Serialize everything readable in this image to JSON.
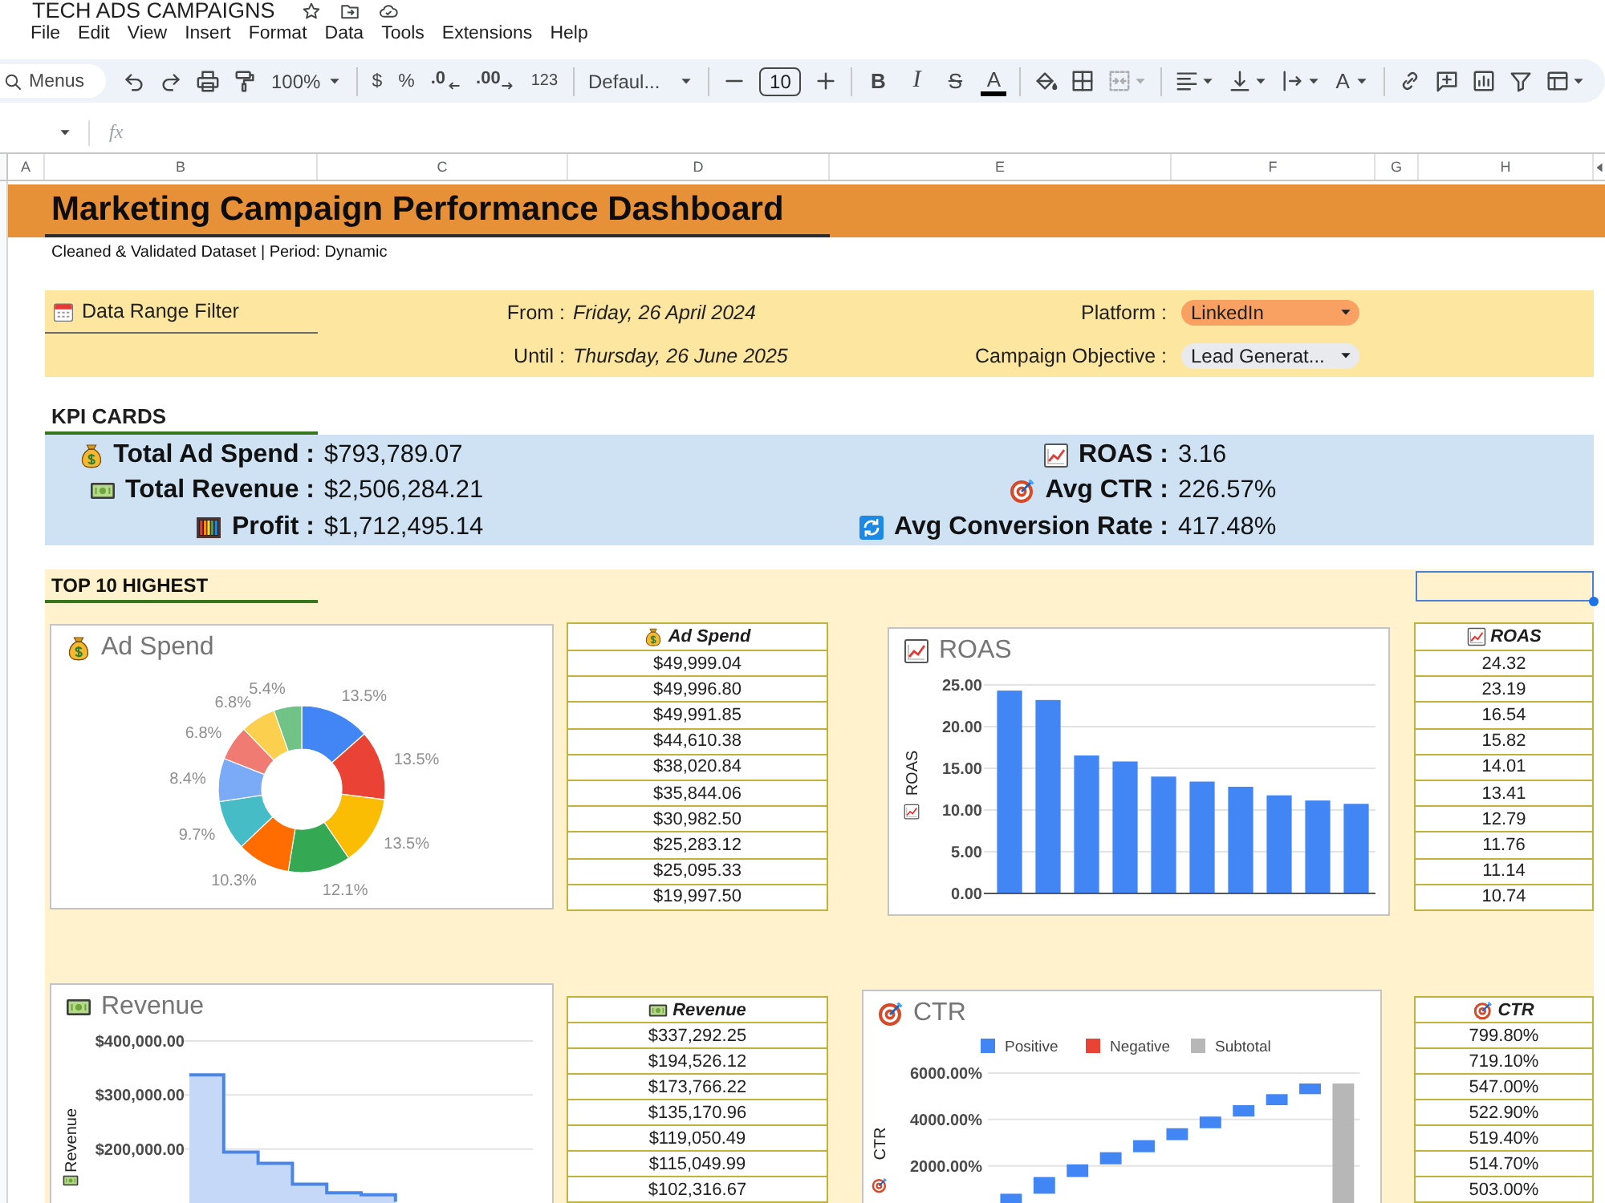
{
  "document": {
    "title": "TECH ADS CAMPAIGNS"
  },
  "menu": [
    "File",
    "Edit",
    "View",
    "Insert",
    "Format",
    "Data",
    "Tools",
    "Extensions",
    "Help"
  ],
  "toolbar": {
    "search": {
      "placeholder": "Menus"
    },
    "zoom": "100%",
    "number_formats": [
      {
        "kind": "currency",
        "label": "$"
      },
      {
        "kind": "percent",
        "label": "%"
      },
      {
        "kind": "decrease_decimals",
        "label": ".0"
      },
      {
        "kind": "increase_decimals",
        "label": ".00"
      },
      {
        "kind": "more_formats",
        "label": "123"
      }
    ],
    "font": "Defaul...",
    "font_size": "10",
    "text_styles": [
      {
        "kind": "bold",
        "label": "B"
      },
      {
        "kind": "italic",
        "label": "I"
      },
      {
        "kind": "strikethrough",
        "label": "S"
      },
      {
        "kind": "text_color",
        "label": "A"
      }
    ],
    "merge_cells": {
      "disabled": true
    },
    "rotate": "A"
  },
  "formula_bar": {
    "label": "fx"
  },
  "columns": [
    "A",
    "B",
    "C",
    "D",
    "E",
    "F",
    "G",
    "H"
  ],
  "dashboard": {
    "title": "Marketing Campaign Performance Dashboard",
    "subtitle": "Cleaned & Validated Dataset | Period: Dynamic",
    "filter": {
      "heading": "Data Range Filter",
      "dates": [
        {
          "label": "From :",
          "value": "Friday, 26 April 2024"
        },
        {
          "label": "Until :",
          "value": "Thursday, 26 June 2025"
        }
      ],
      "dropdowns": [
        {
          "label": "Platform :",
          "value": "LinkedIn",
          "color": "#f9a063"
        },
        {
          "label": "Campaign Objective :",
          "value": "Lead Generat...",
          "color": "#e8eaed"
        }
      ]
    },
    "kpi": {
      "heading": "KPI CARDS",
      "left": [
        {
          "label": "Total Ad Spend :",
          "value": "$793,789.07"
        },
        {
          "label": "Total Revenue :",
          "value": "$2,506,284.21"
        },
        {
          "label": "Profit :",
          "value": "$1,712,495.14"
        }
      ],
      "right": [
        {
          "label": "ROAS :",
          "value": "3.16"
        },
        {
          "label": "Avg CTR :",
          "value": "226.57%"
        },
        {
          "label": "Avg Conversion Rate :",
          "value": "417.48%"
        }
      ]
    },
    "top10": {
      "heading": "TOP 10 HIGHEST",
      "selected_cell": {
        "selected": true
      },
      "panels": [
        {
          "chart_data": {
            "type": "donut",
            "title": "Ad Spend",
            "values": [
              13.5,
              13.5,
              13.5,
              12.1,
              10.3,
              9.7,
              8.4,
              6.8,
              6.8,
              5.4
            ],
            "colors": [
              "#4285f4",
              "#ea4335",
              "#fbbc04",
              "#34a853",
              "#ff6d01",
              "#46bdc6",
              "#7baaf7",
              "#f07b72",
              "#fcd04f",
              "#71c287"
            ],
            "value_labels": [
              "13.5%",
              "13.5%",
              "13.5%",
              "12.1%",
              "10.3%",
              "9.7%",
              "8.4%",
              "6.8%",
              "6.8%",
              "5.4%"
            ]
          },
          "table": {
            "header": "Ad Spend",
            "rows": [
              "$49,999.04",
              "$49,996.80",
              "$49,991.85",
              "$44,610.38",
              "$38,020.84",
              "$35,844.06",
              "$30,982.50",
              "$25,283.12",
              "$25,095.33",
              "$19,997.50"
            ]
          }
        },
        {
          "chart_data": {
            "type": "bar",
            "title": "ROAS",
            "ylabel": "ROAS",
            "values": [
              24.32,
              23.19,
              16.54,
              15.82,
              14.01,
              13.41,
              12.79,
              11.76,
              11.14,
              10.74
            ],
            "color": "#4285f4",
            "ylim": [
              0,
              25
            ],
            "yticks": [
              {
                "value": 0,
                "label": "0.00"
              },
              {
                "value": 5,
                "label": "5.00"
              },
              {
                "value": 10,
                "label": "10.00"
              },
              {
                "value": 15,
                "label": "15.00"
              },
              {
                "value": 20,
                "label": "20.00"
              },
              {
                "value": 25,
                "label": "25.00"
              }
            ],
            "grid": true
          },
          "table": {
            "header": "ROAS",
            "rows": [
              "24.32",
              "23.19",
              "16.54",
              "15.82",
              "14.01",
              "13.41",
              "12.79",
              "11.76",
              "11.14",
              "10.74"
            ]
          }
        },
        {
          "chart_data": {
            "type": "step",
            "title": "Revenue",
            "ylabel": "Revenue",
            "categories": [
              null,
              null,
              null,
              null,
              null,
              null,
              null
            ],
            "values": [
              337292.25,
              194526.12,
              173766.22,
              135170.96,
              119050.49,
              115049.99,
              102316.67
            ],
            "ylim": [
              100000,
              400000
            ],
            "yticks": [
              {
                "value": 200000,
                "label": "$200,000.00"
              },
              {
                "value": 300000,
                "label": "$300,000.00"
              },
              {
                "value": 400000,
                "label": "$400,000.00"
              }
            ],
            "color": "#4a86e8",
            "grid": true
          },
          "table": {
            "header": "Revenue",
            "rows": [
              "$337,292.25",
              "$194,526.12",
              "$173,766.22",
              "$135,170.96",
              "$119,050.49",
              "$115,049.99",
              "$102,316.67"
            ]
          }
        },
        {
          "chart_data": {
            "type": "bar",
            "title": "CTR",
            "ylabel": "CTR",
            "legend": "top",
            "series": [
              {
                "name": "Positive",
                "color": "#4285f4",
                "values": [
                  799.8,
                  719.1,
                  547.0,
                  522.9,
                  519.4,
                  514.7,
                  503.0,
                  490,
                  475,
                  460,
                  null
                ],
                "base": [
                  0,
                  799.8,
                  1518.9,
                  2065.9,
                  2588.8,
                  3108.2,
                  3622.9,
                  4125.9,
                  4615.9,
                  5090.9,
                  null
                ]
              },
              {
                "name": "Negative",
                "color": "#ea4335",
                "values": [
                  null,
                  null,
                  null,
                  null,
                  null,
                  null,
                  null,
                  null,
                  null,
                  null,
                  null
                ]
              },
              {
                "name": "Subtotal",
                "color": "#b7b7b7",
                "values": [
                  null,
                  null,
                  null,
                  null,
                  null,
                  null,
                  null,
                  null,
                  null,
                  null,
                  5550.9
                ],
                "base": [
                  null,
                  null,
                  null,
                  null,
                  null,
                  null,
                  null,
                  null,
                  null,
                  null,
                  0
                ]
              }
            ],
            "ylim": [
              400,
              6000
            ],
            "yticks": [
              {
                "value": 2000,
                "label": "2000.00%"
              },
              {
                "value": 4000,
                "label": "4000.00%"
              },
              {
                "value": 6000,
                "label": "6000.00%"
              }
            ],
            "grid": true
          },
          "table": {
            "header": "CTR",
            "rows": [
              "799.80%",
              "719.10%",
              "547.00%",
              "522.90%",
              "519.40%",
              "514.70%",
              "503.00%"
            ]
          }
        }
      ]
    }
  }
}
